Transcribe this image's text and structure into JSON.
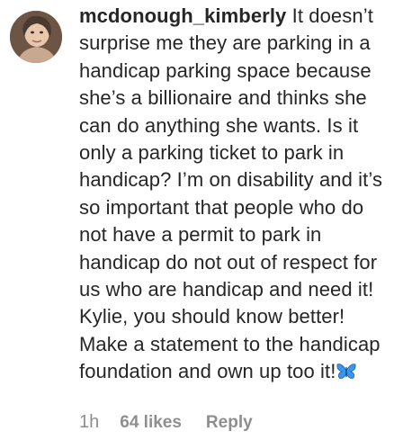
{
  "comment": {
    "username": "mcdonough_kimberly",
    "text": "It doesn’t surprise me they are parking in a handicap parking space because she’s a billionaire and thinks she can do anything she wants. Is it only a parking ticket to park in handicap? I’m on disability and it’s so important that people who do not have a permit to park in handicap do not out of respect for us who are handicap and need it! Kylie, you should know better! Make a statement to the handicap foundation and own up too it!",
    "emoji": "butterfly",
    "time": "1h",
    "likes": "64 likes",
    "reply_label": "Reply"
  },
  "colors": {
    "text": "#262626",
    "meta": "#8e8e8e",
    "emoji": "#3897f0"
  }
}
